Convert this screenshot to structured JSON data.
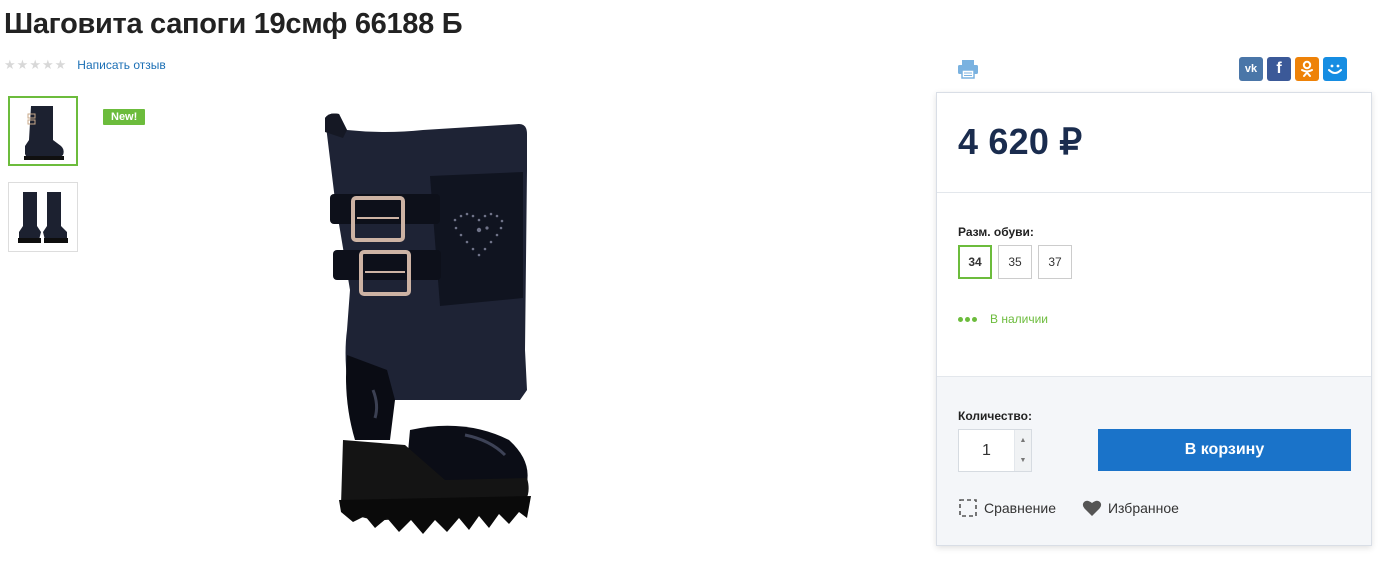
{
  "product": {
    "title": "Шаговита сапоги 19смф 66188 Б",
    "review_link": "Написать отзыв",
    "rating_stars": 5,
    "badge": "New!"
  },
  "share": {
    "buttons": [
      "vk-icon",
      "facebook-icon",
      "odnoklassniki-icon",
      "mailru-icon"
    ]
  },
  "price": {
    "value": "4 620",
    "currency": "₽"
  },
  "options": {
    "size_label": "Разм. обуви:",
    "sizes": [
      "34",
      "35",
      "37"
    ],
    "selected_size": "34",
    "stock_status": "В наличии"
  },
  "buy": {
    "qty_label": "Количество:",
    "qty_value": "1",
    "cart_button": "В корзину",
    "compare_label": "Сравнение",
    "favorite_label": "Избранное"
  },
  "colors": {
    "accent_green": "#6cbc3c",
    "button_blue": "#1a73c9",
    "price_navy": "#1a2c4e",
    "link_blue": "#1b6fb5"
  }
}
